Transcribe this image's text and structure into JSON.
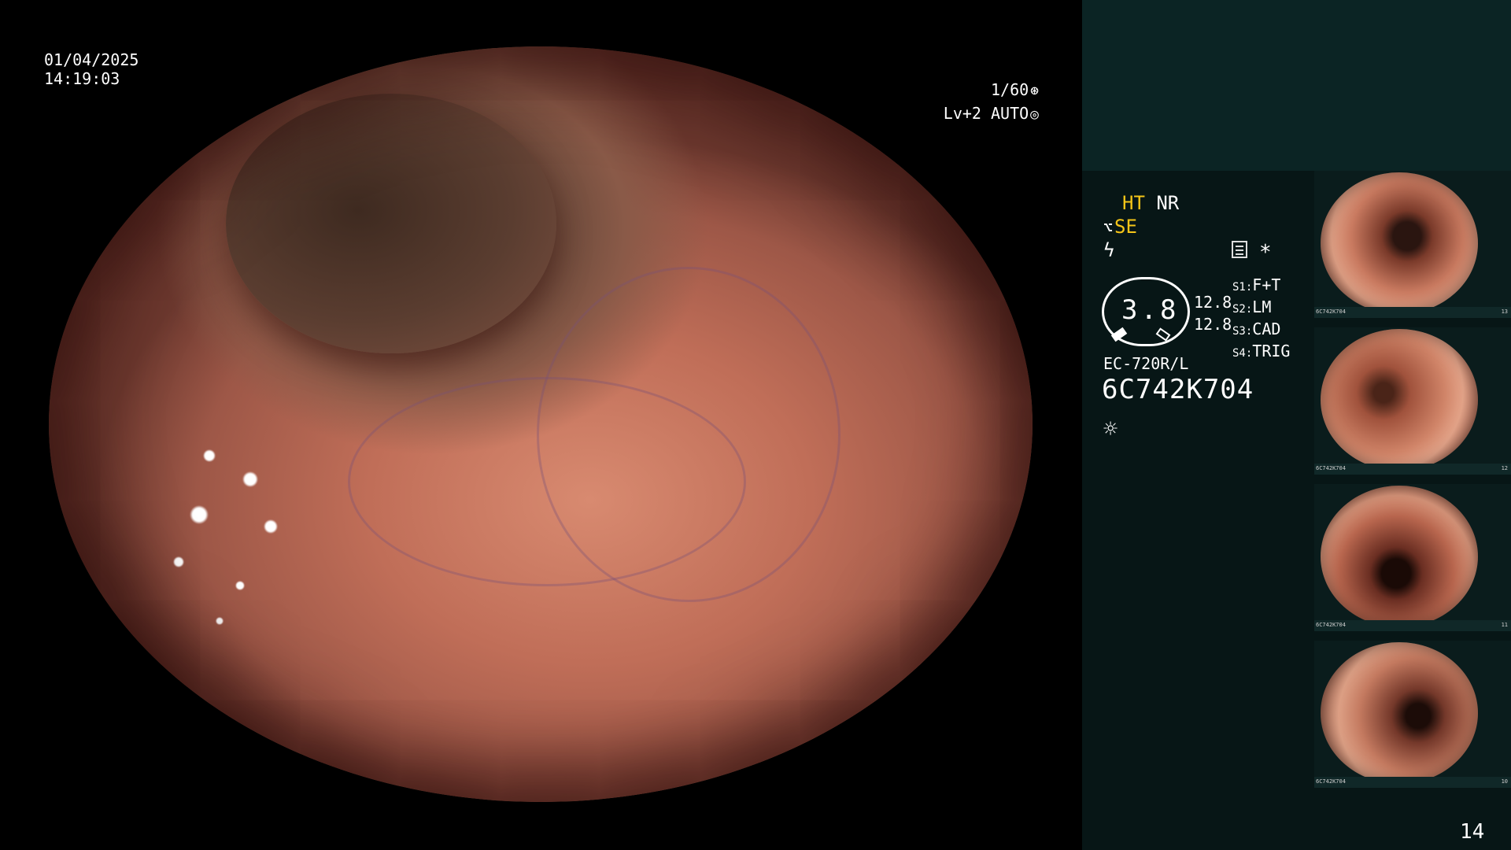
{
  "overlay": {
    "date": "01/04/2025",
    "time": "14:19:03",
    "shutter": "1/60",
    "shutter_icon": "aperture-icon",
    "level": "Lv+2 AUTO",
    "level_icon": "iris-icon"
  },
  "panel": {
    "ht_label": "HT",
    "nr_label": "NR",
    "se_label": "SE",
    "se_icon": "scope-tip-icon",
    "flash_icon": "lightning-icon",
    "menu_icon": "list-icon",
    "star": "*",
    "gauge_value": "3.8",
    "gauge_n1": "12.8",
    "gauge_n2": "12.8",
    "s_items": [
      {
        "label": "S1",
        "value": "F+T"
      },
      {
        "label": "S2",
        "value": "LM"
      },
      {
        "label": "S3",
        "value": "CAD"
      },
      {
        "label": "S4",
        "value": "TRIG"
      }
    ],
    "model": "EC-720R/L",
    "serial": "6C742K704",
    "sun_icon": "sun-icon"
  },
  "thumbnails": [
    {
      "meta": "6C742K704",
      "index": "13"
    },
    {
      "meta": "6C742K704",
      "index": "12"
    },
    {
      "meta": "6C742K704",
      "index": "11"
    },
    {
      "meta": "6C742K704",
      "index": "10"
    }
  ],
  "page_number": "14"
}
